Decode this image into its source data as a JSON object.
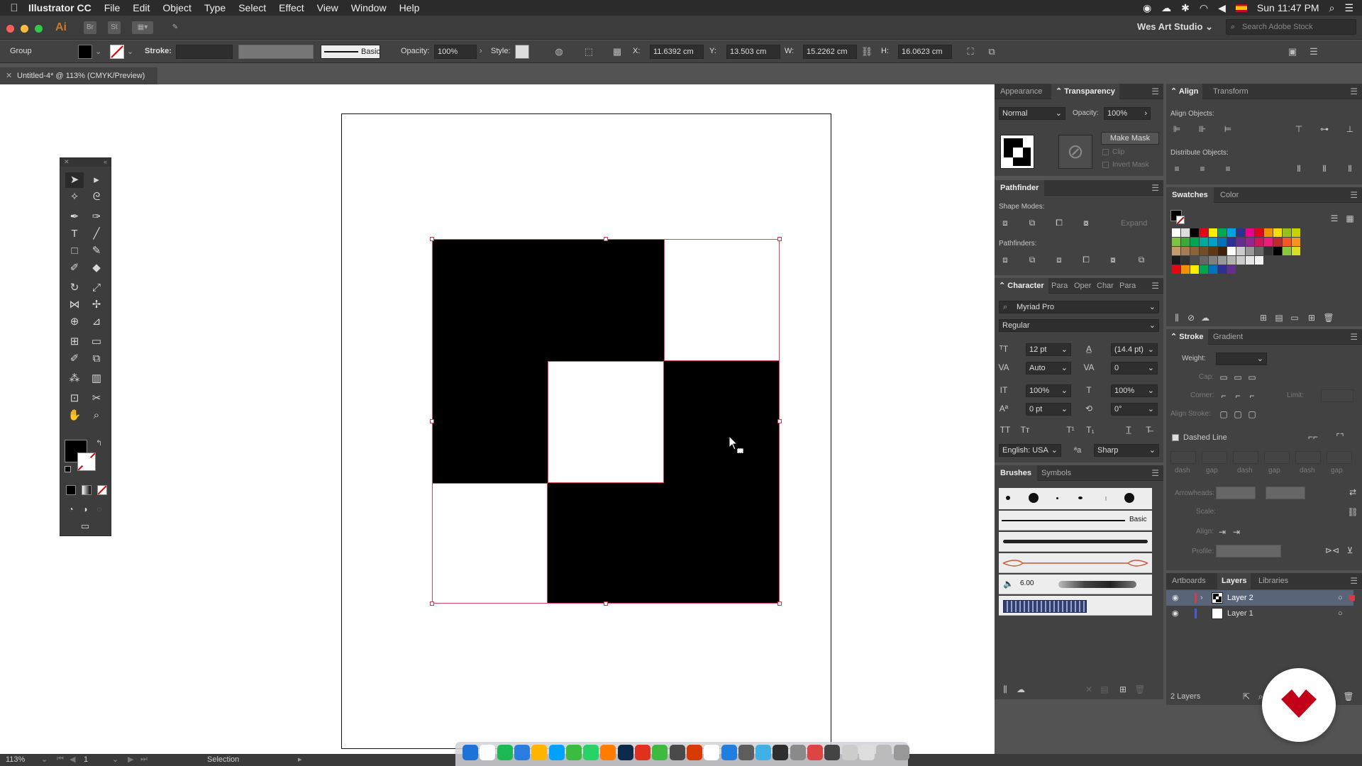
{
  "menubar": {
    "app_name": "Illustrator CC",
    "items": [
      "File",
      "Edit",
      "Object",
      "Type",
      "Select",
      "Effect",
      "View",
      "Window",
      "Help"
    ],
    "clock": "Sun 11:47 PM"
  },
  "appbar": {
    "ai_label": "Ai",
    "br_label": "Br",
    "st_label": "St",
    "workspace": "Wes Art Studio",
    "search_placeholder": "Search Adobe Stock"
  },
  "controlbar": {
    "selection_type": "Group",
    "stroke_label": "Stroke:",
    "brush_label": "Basic",
    "opacity_label": "Opacity:",
    "opacity_value": "100%",
    "style_label": "Style:",
    "x_label": "X:",
    "x_value": "11.6392 cm",
    "y_label": "Y:",
    "y_value": "13.503 cm",
    "w_label": "W:",
    "w_value": "15.2262 cm",
    "h_label": "H:",
    "h_value": "16.0623 cm"
  },
  "document": {
    "tab_title": "Untitled-4* @ 113% (CMYK/Preview)"
  },
  "transparency_panel": {
    "tab_appearance": "Appearance",
    "tab_transparency": "Transparency",
    "blend_mode": "Normal",
    "opacity_label": "Opacity:",
    "opacity_value": "100%",
    "make_mask": "Make Mask",
    "clip": "Clip",
    "invert_mask": "Invert Mask"
  },
  "pathfinder_panel": {
    "title": "Pathfinder",
    "shape_modes": "Shape Modes:",
    "expand": "Expand",
    "pathfinders": "Pathfinders:"
  },
  "character_panel": {
    "tabs": [
      "Character",
      "Para",
      "Oper",
      "Char",
      "Para"
    ],
    "font_family": "Myriad Pro",
    "font_style": "Regular",
    "size": "12 pt",
    "leading": "(14.4 pt)",
    "kerning": "Auto",
    "tracking": "0",
    "vscale": "100%",
    "hscale": "100%",
    "baseline": "0 pt",
    "rotation": "0°",
    "language": "English: USA",
    "aa_label": "ªa",
    "antialias": "Sharp"
  },
  "brushes_panel": {
    "tab_brushes": "Brushes",
    "tab_symbols": "Symbols",
    "basic_label": "Basic",
    "size_value": "6.00"
  },
  "align_panel": {
    "tab_align": "Align",
    "tab_transform": "Transform",
    "align_objects": "Align Objects:",
    "distribute_objects": "Distribute Objects:"
  },
  "swatches_panel": {
    "tab_swatches": "Swatches",
    "tab_color": "Color"
  },
  "stroke_panel": {
    "tab_stroke": "Stroke",
    "tab_gradient": "Gradient",
    "weight": "Weight:",
    "cap": "Cap:",
    "corner": "Corner:",
    "limit": "Limit:",
    "align_stroke": "Align Stroke:",
    "dashed_line": "Dashed Line",
    "dash_labels": [
      "dash",
      "gap",
      "dash",
      "gap",
      "dash",
      "gap"
    ],
    "arrowheads": "Arrowheads:",
    "scale": "Scale:",
    "align": "Align:",
    "profile": "Profile:"
  },
  "layers_panel": {
    "tab_artboards": "Artboards",
    "tab_layers": "Layers",
    "tab_libraries": "Libraries",
    "layers": [
      "Layer 2",
      "Layer 1"
    ],
    "count": "2 Layers"
  },
  "statusbar": {
    "zoom": "113%",
    "artboard_number": "1",
    "mode": "Selection"
  },
  "colors": {
    "selection": "#d04a5a",
    "layer2_color": "#d63b4a",
    "layer1_color": "#4a5bd6",
    "logo_red": "#c2001a"
  }
}
